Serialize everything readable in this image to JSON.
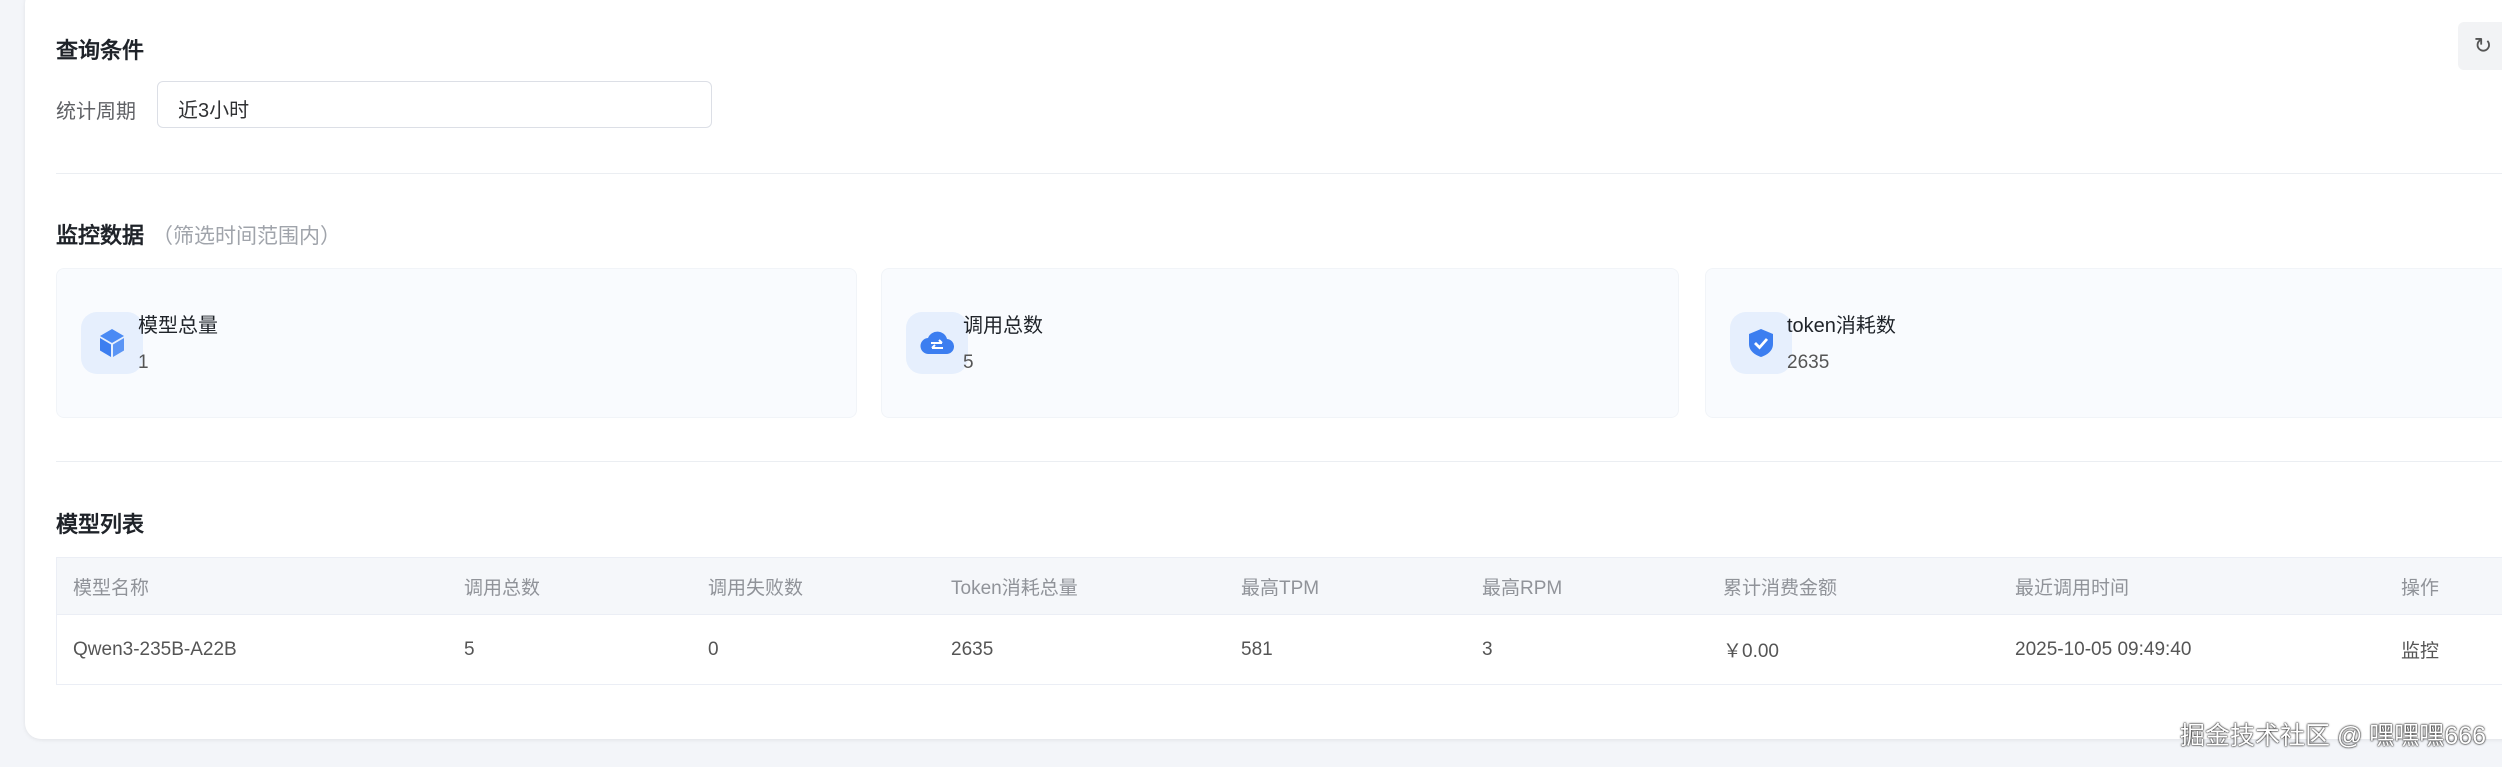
{
  "query": {
    "title": "查询条件",
    "period_label": "统计周期",
    "period_value": "近3小时",
    "refresh_icon": "refresh-icon"
  },
  "monitor": {
    "title": "监控数据",
    "subtitle": "（筛选时间范围内）",
    "cards": [
      {
        "label": "模型总量",
        "value": "1",
        "icon": "cube-icon"
      },
      {
        "label": "调用总数",
        "value": "5",
        "icon": "cloud-transfer-icon"
      },
      {
        "label": "token消耗数",
        "value": "2635",
        "icon": "shield-check-icon"
      }
    ]
  },
  "models": {
    "title": "模型列表",
    "columns": [
      "模型名称",
      "调用总数",
      "调用失败数",
      "Token消耗总量",
      "最高TPM",
      "最高RPM",
      "累计消费金额",
      "最近调用时间",
      "操作"
    ],
    "rows": [
      [
        "Qwen3-235B-A22B",
        "5",
        "0",
        "2635",
        "581",
        "3",
        "￥0.00",
        "2025-10-05 09:49:40",
        "监控"
      ]
    ]
  },
  "watermark": "掘金技术社区 @ 嘿嘿嘿666",
  "colors": {
    "accent": "#3c7ef0",
    "icon_bg": "#e6effd"
  }
}
